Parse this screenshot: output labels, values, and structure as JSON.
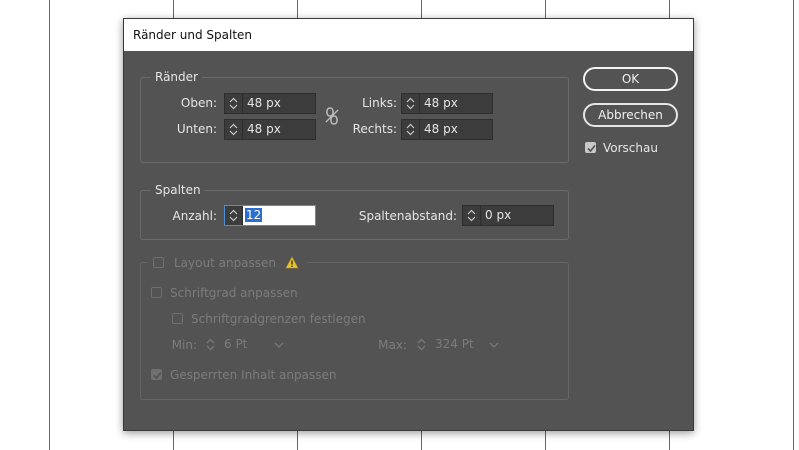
{
  "dialog": {
    "title": "Ränder und Spalten"
  },
  "margins": {
    "legend": "Ränder",
    "top_label": "Oben:",
    "top_value": "48 px",
    "bottom_label": "Unten:",
    "bottom_value": "48 px",
    "left_label": "Links:",
    "left_value": "48 px",
    "right_label": "Rechts:",
    "right_value": "48 px",
    "link_icon": "chain-link-icon"
  },
  "columns": {
    "legend": "Spalten",
    "count_label": "Anzahl:",
    "count_value": "12",
    "gutter_label": "Spaltenabstand:",
    "gutter_value": "0 px"
  },
  "layout": {
    "checkbox_label": "Layout anpassen",
    "checked": false,
    "enabled": false,
    "warning_icon": "warning-icon",
    "warning_color": "#e8c32a",
    "font_size_label": "Schriftgrad anpassen",
    "font_size_checked": false,
    "limits_label": "Schriftgradgrenzen festlegen",
    "limits_checked": false,
    "min_label": "Min:",
    "min_value": "6 Pt",
    "max_label": "Max:",
    "max_value": "324 Pt",
    "locked_label": "Gesperrten Inhalt anpassen",
    "locked_checked": true
  },
  "buttons": {
    "ok": "OK",
    "cancel": "Abbrechen"
  },
  "preview": {
    "label": "Vorschau",
    "checked": true
  },
  "colors": {
    "dialog_bg": "#535353",
    "guide": "#9b3bb8",
    "selection": "#2a6fd0"
  }
}
